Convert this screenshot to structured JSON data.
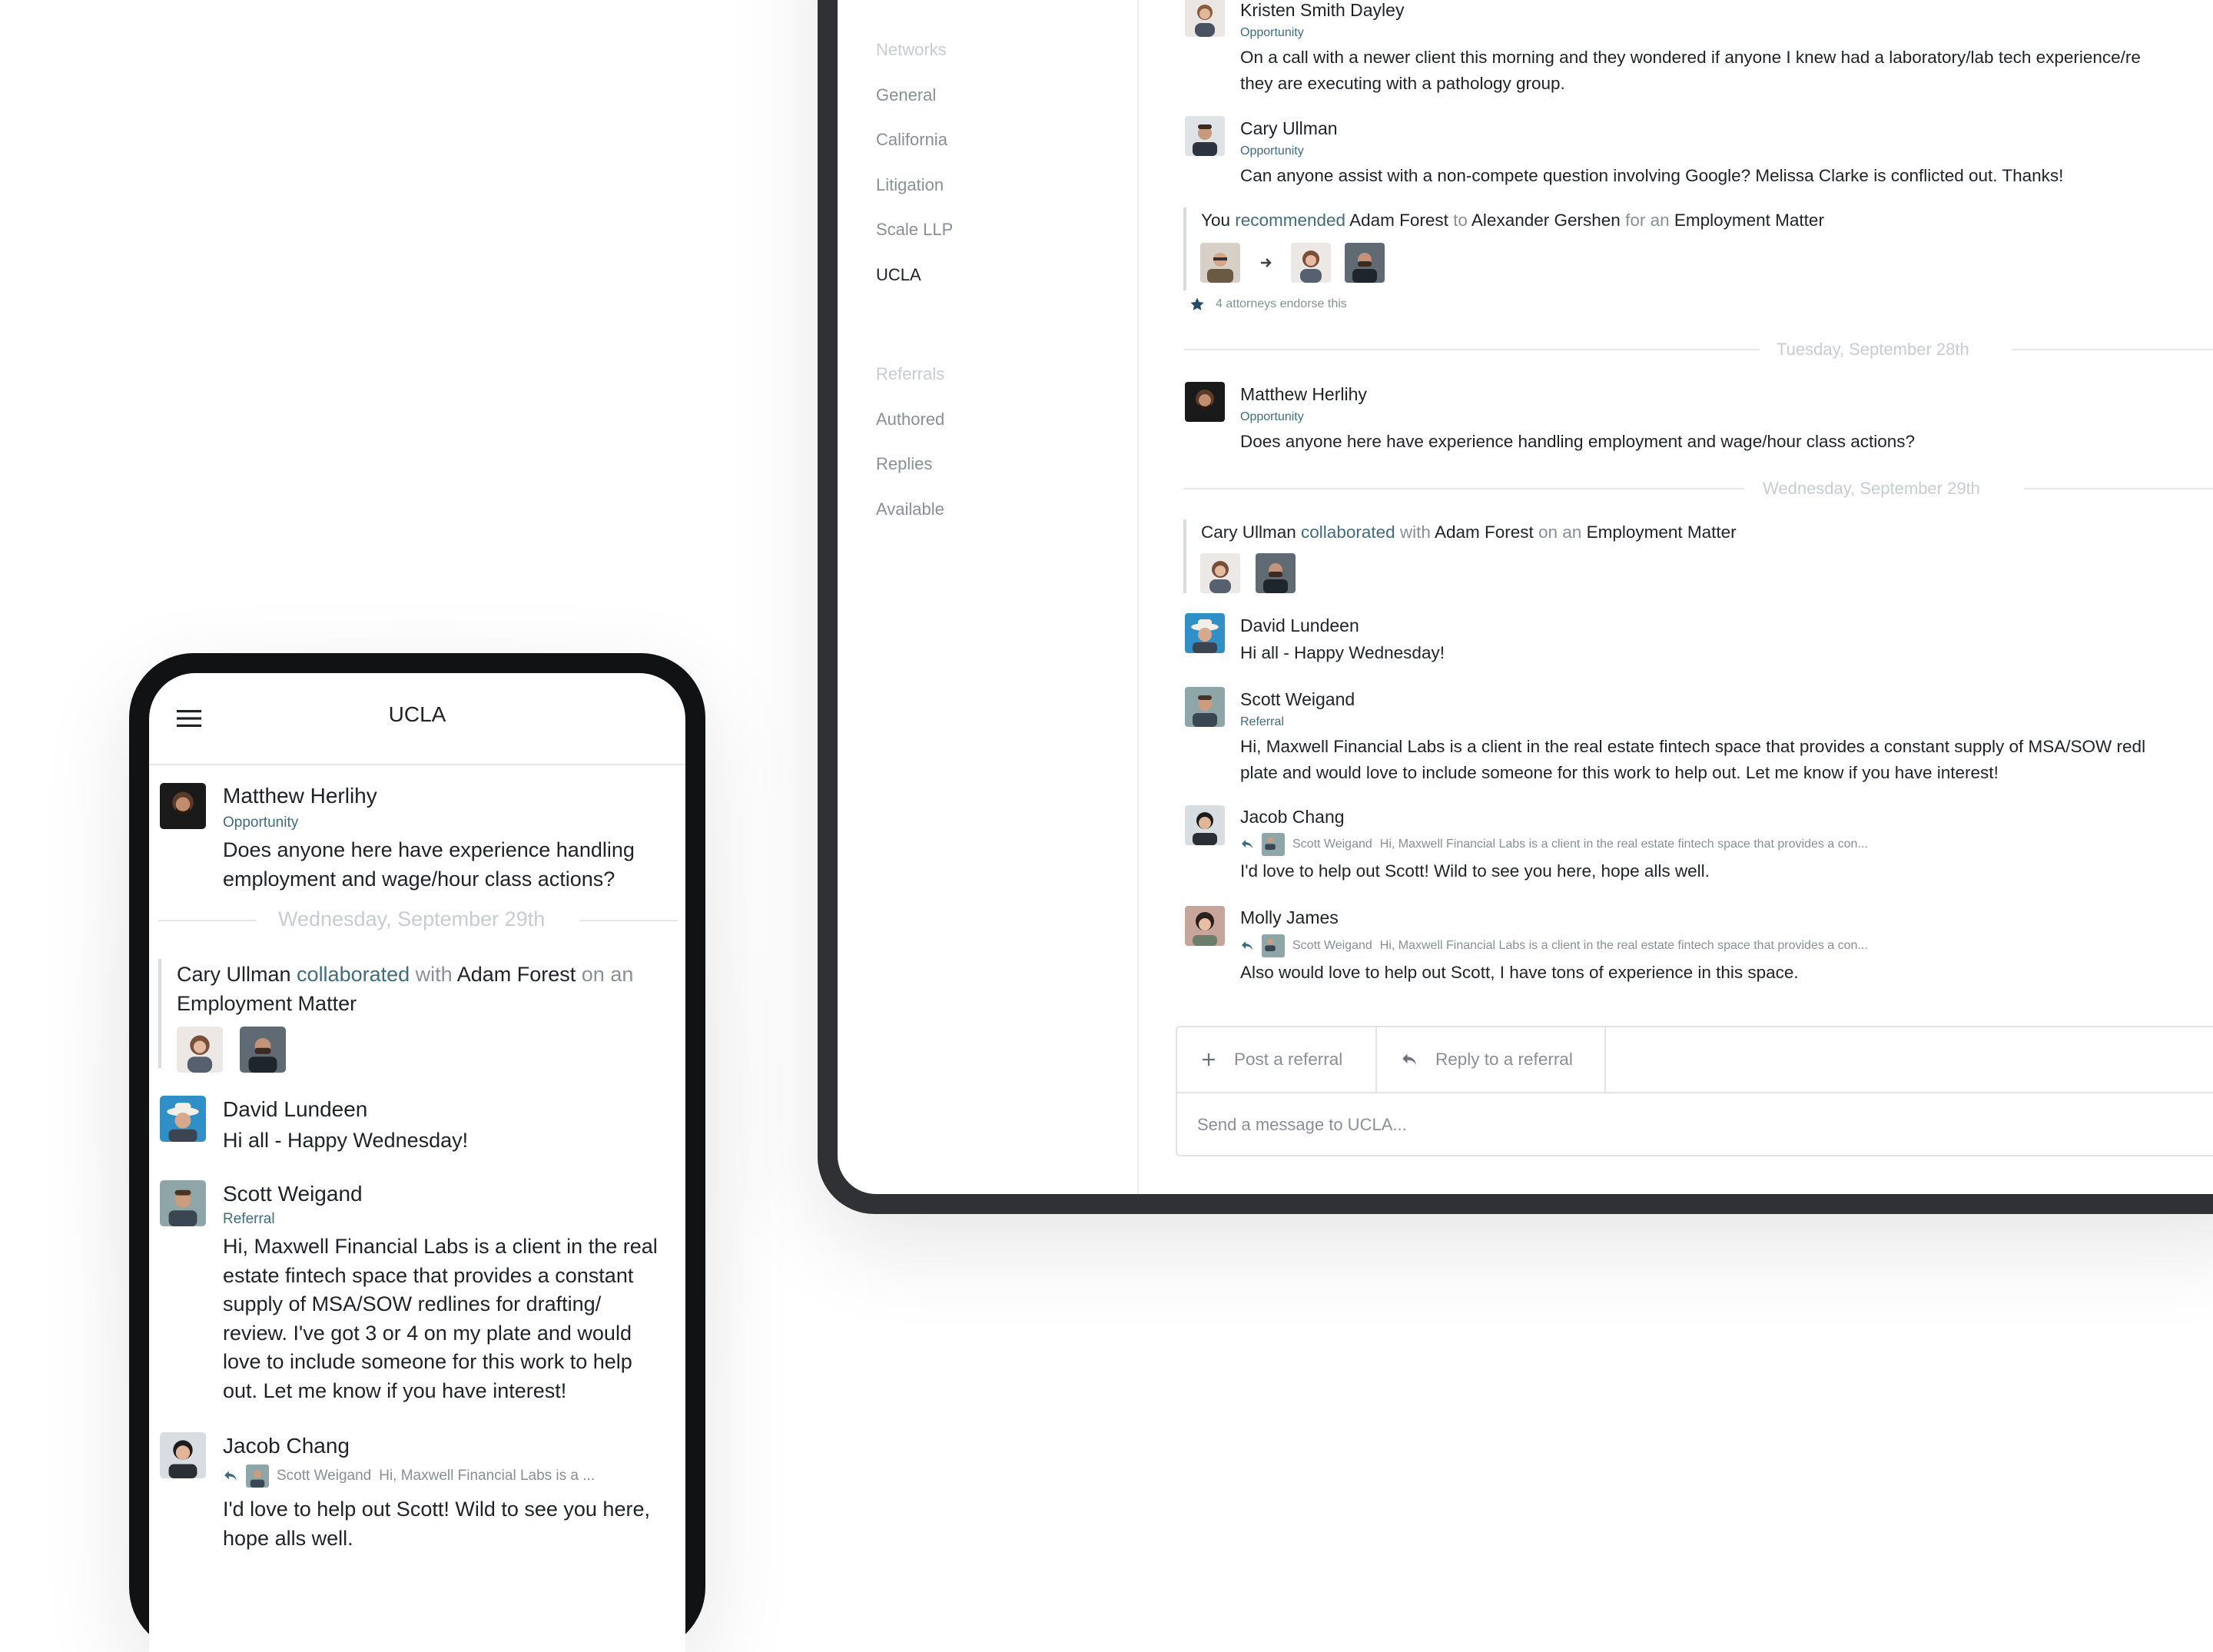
{
  "tablet": {
    "sidebar": {
      "networks_heading": "Networks",
      "networks": [
        {
          "label": "General"
        },
        {
          "label": "California"
        },
        {
          "label": "Litigation"
        },
        {
          "label": "Scale LLP"
        },
        {
          "label": "UCLA",
          "active": true
        }
      ],
      "referrals_heading": "Referrals",
      "referrals": [
        {
          "label": "Authored"
        },
        {
          "label": "Replies"
        },
        {
          "label": "Available"
        }
      ]
    },
    "feed": {
      "post1": {
        "name": "Kristen Smith Dayley",
        "tag": "Opportunity",
        "line1": "On a call with a newer client this morning and they wondered if anyone I knew had a laboratory/lab tech experience/re",
        "line2": "they are executing with a pathology group."
      },
      "post2": {
        "name": "Cary Ullman",
        "tag": "Opportunity",
        "line1": "Can anyone assist with a non-compete question involving Google? Melissa Clarke is conflicted out. Thanks!"
      },
      "activity1": {
        "actor": "You",
        "verb": "recommended",
        "subject": "Adam Forest",
        "to": "to",
        "target": "Alexander Gershen",
        "for": "for an",
        "matter": "Employment Matter",
        "endorse": "4 attorneys endorse this"
      },
      "divider1": "Tuesday, September 28th",
      "post3": {
        "name": "Matthew Herlihy",
        "tag": "Opportunity",
        "line1": "Does anyone here have experience handling employment and wage/hour class actions?"
      },
      "divider2": "Wednesday, September 29th",
      "activity2": {
        "actor": "Cary Ullman",
        "verb": "collaborated",
        "with": "with",
        "subject": "Adam Forest",
        "on": "on an",
        "matter": "Employment Matter"
      },
      "post4": {
        "name": "David Lundeen",
        "line1": "Hi all - Happy Wednesday!"
      },
      "post5": {
        "name": "Scott Weigand",
        "tag": "Referral",
        "line1": "Hi, Maxwell Financial Labs is a client in the real estate fintech space that provides a constant supply of MSA/SOW redl",
        "line2": "plate and would love to include someone for this work to help out. Let me know if you have interest!"
      },
      "post6": {
        "name": "Jacob Chang",
        "reply_name": "Scott Weigand",
        "reply_snippet": "Hi, Maxwell Financial Labs is a client in the real estate fintech space that provides a con...",
        "line1": "I'd love to help out Scott! Wild to see you here, hope alls well."
      },
      "post7": {
        "name": "Molly James",
        "reply_name": "Scott Weigand",
        "reply_snippet": "Hi, Maxwell Financial Labs is a client in the real estate fintech space that provides a con...",
        "line1": "Also would love to help out Scott, I have tons of experience in this space."
      }
    },
    "composer": {
      "post_label": "Post a referral",
      "reply_label": "Reply to a referral",
      "placeholder": "Send a message to UCLA..."
    }
  },
  "phone": {
    "title": "UCLA",
    "post1": {
      "name": "Matthew Herlihy",
      "tag": "Opportunity",
      "line1": "Does anyone here have experience handling",
      "line2": "employment and wage/hour class actions?"
    },
    "divider": "Wednesday, September 29th",
    "activity": {
      "actor": "Cary Ullman",
      "verb": "collaborated",
      "with": "with",
      "subject": "Adam Forest",
      "on": "on an",
      "matter": "Employment Matter"
    },
    "post2": {
      "name": "David Lundeen",
      "line1": "Hi all - Happy Wednesday!"
    },
    "post3": {
      "name": "Scott Weigand",
      "tag": "Referral",
      "lines": [
        "Hi, Maxwell Financial Labs is a client in the real",
        "estate fintech space that provides a constant",
        "supply of MSA/SOW redlines for drafting/",
        "review. I've got 3 or 4 on my plate and would",
        "love to include someone for this work to help",
        "out. Let me know if you have interest!"
      ]
    },
    "post4": {
      "name": "Jacob Chang",
      "reply_name": "Scott Weigand",
      "reply_snippet": "Hi, Maxwell Financial Labs is a ...",
      "line1": "I'd love to help out Scott! Wild to see you here,",
      "line2": "hope alls well."
    }
  },
  "colors": {
    "accent_teal": "#3e6c80",
    "muted_text": "#8a8f96",
    "tablet_bezel": "#2f3135",
    "phone_bezel": "#111214"
  },
  "icons": [
    "hamburger-icon",
    "plus-icon",
    "reply-arrow-icon",
    "star-icon",
    "arrow-right-icon"
  ]
}
